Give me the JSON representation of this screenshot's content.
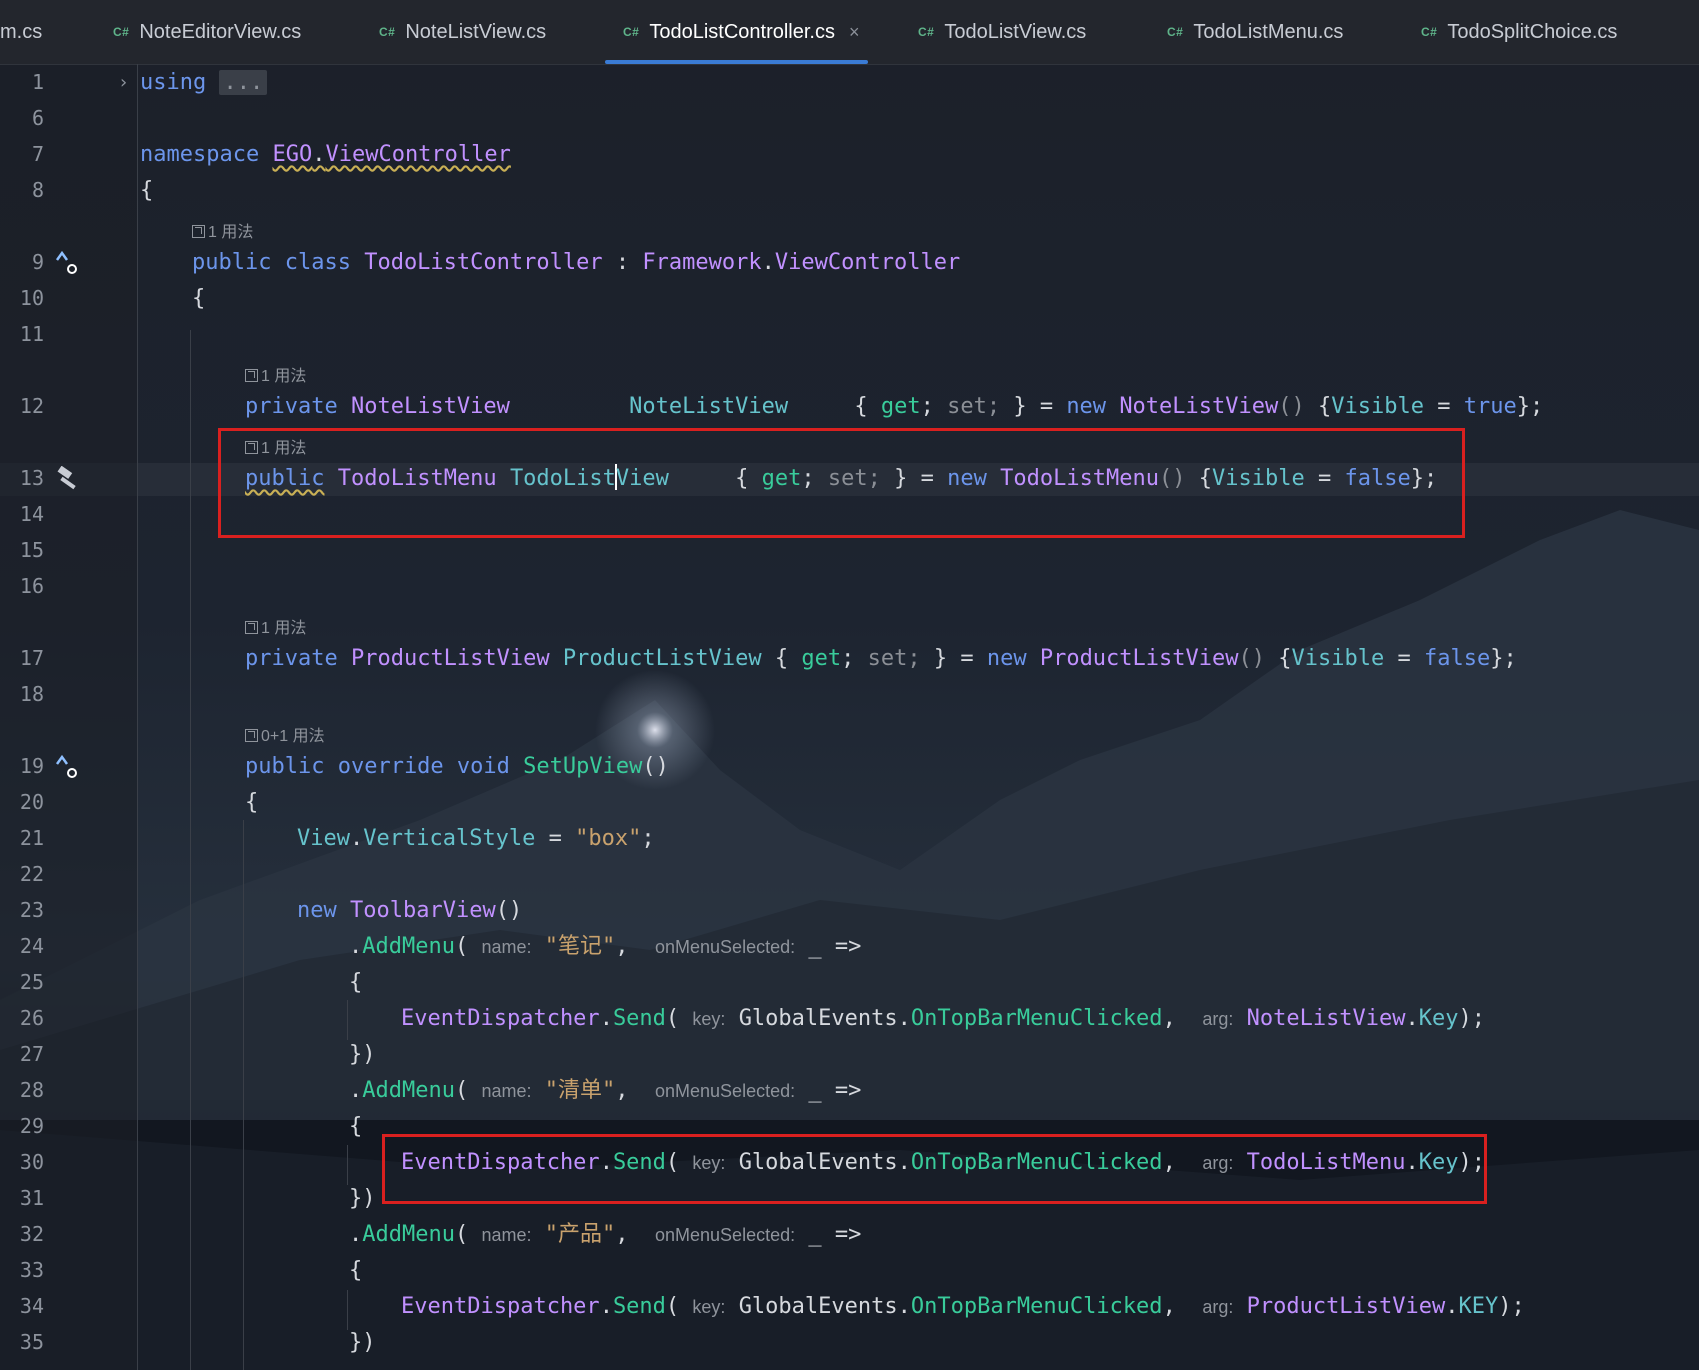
{
  "tabs": [
    {
      "label": "m.cs",
      "badge": ""
    },
    {
      "label": "NoteEditorView.cs",
      "badge": "C#"
    },
    {
      "label": "NoteListView.cs",
      "badge": "C#"
    },
    {
      "label": "TodoListController.cs",
      "badge": "C#",
      "active": true
    },
    {
      "label": "TodoListView.cs",
      "badge": "C#"
    },
    {
      "label": "TodoListMenu.cs",
      "badge": "C#"
    },
    {
      "label": "TodoSplitChoice.cs",
      "badge": "C#"
    }
  ],
  "close_glyph": "×",
  "usage_hints": {
    "one": "1 用法",
    "zero_plus_one": "0+1 用法"
  },
  "line_numbers": [
    "1",
    "6",
    "7",
    "8",
    "9",
    "10",
    "11",
    "12",
    "13",
    "14",
    "15",
    "16",
    "17",
    "18",
    "19",
    "20",
    "21",
    "22",
    "23",
    "24",
    "25",
    "26",
    "27",
    "28",
    "29",
    "30",
    "31",
    "32",
    "33",
    "34",
    "35"
  ],
  "code": {
    "l1_using": "using",
    "l1_fold": "...",
    "l7_kw": "namespace",
    "l7_ns1": "EGO",
    "l7_dot": ".",
    "l7_ns2": "ViewController",
    "brace_open": "{",
    "l9_kw": "public class",
    "l9_cls": "TodoListController",
    "l9_colon": " : ",
    "l9_base1": "Framework",
    "l9_base2": "ViewController",
    "l12_kw": "private",
    "l12_type": "NoteListView",
    "l12_name": "NoteListView",
    "l12_acc1": "{ ",
    "get": "get",
    "set": "set",
    "acc_end": "; }",
    "eq_new": " = ",
    "new": "new",
    "l12_ctor": "NoteListView",
    "paren_empty": "()",
    "visible": "Visible",
    "true": "true",
    "false": "false",
    "end_brace": "};",
    "l13_kw": "public",
    "l13_type": "TodoListMenu",
    "l13_name_a": "TodoList",
    "l13_name_b": "View",
    "l13_ctor": "TodoListMenu",
    "l17_kw": "private",
    "l17_type": "ProductListView",
    "l17_name": "ProductListView",
    "l17_ctor": "ProductListView",
    "l19_kw": "public override void",
    "l19_fn": "SetUpView",
    "l21_a": "View",
    "l21_b": "VerticalStyle",
    "l21_val": "\"box\"",
    "l23_ctor": "ToolbarView",
    "addmenu": "AddMenu",
    "ph_name": "name:",
    "ph_menu": "onMenuSelected:",
    "lambda": "_ =>",
    "str_note": "\"笔记\"",
    "str_list": "\"清单\"",
    "str_prod": "\"产品\"",
    "dispatcher": "EventDispatcher",
    "send": "Send",
    "ph_key": "key:",
    "ph_arg": "arg:",
    "globalevents": "GlobalEvents",
    "ontopbar": "OnTopBarMenuClicked",
    "arg_note": "NoteListView",
    "arg_todo": "TodoListMenu",
    "arg_prod": "ProductListView",
    "key_lower": "Key",
    "key_upper": "KEY",
    "close_call": "})"
  }
}
